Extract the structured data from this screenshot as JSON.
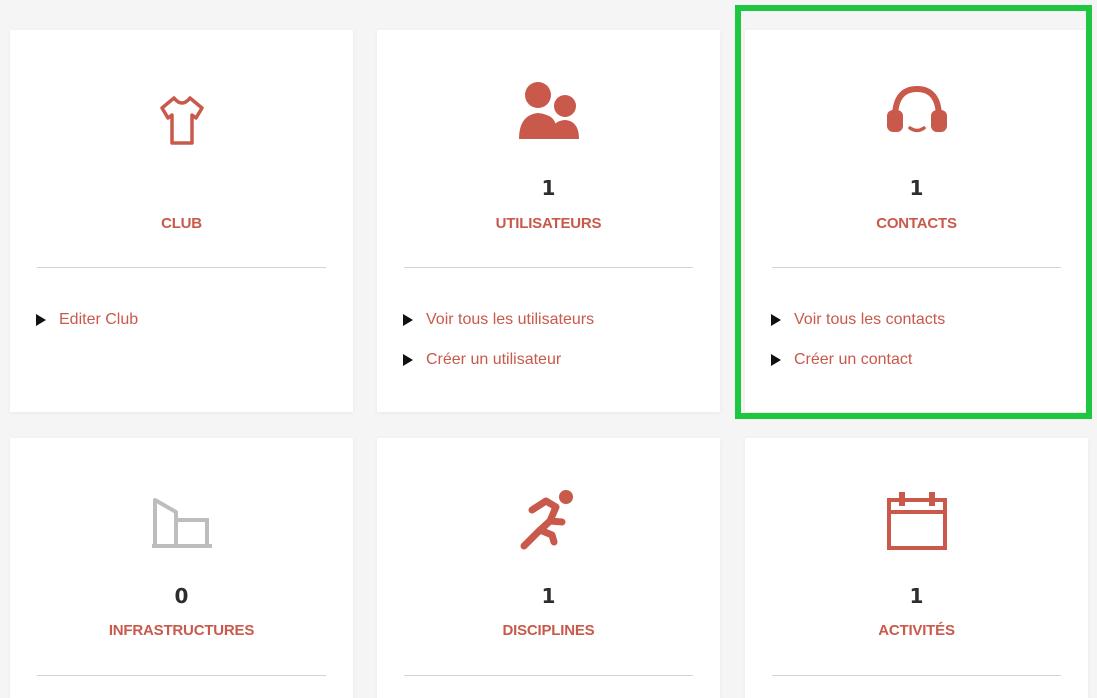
{
  "colors": {
    "accent": "#c8594b",
    "muted": "#bdbdbd",
    "highlight": "#1fc63f",
    "text": "#2d2d2d"
  },
  "cards": [
    {
      "icon": "tshirt-icon",
      "title": "CLUB",
      "count": "",
      "links": [
        {
          "label": "Editer Club"
        }
      ]
    },
    {
      "icon": "users-icon",
      "title": "UTILISATEURS",
      "count": "1",
      "links": [
        {
          "label": "Voir tous les utilisateurs"
        },
        {
          "label": "Créer un utilisateur"
        }
      ]
    },
    {
      "icon": "headset-icon",
      "title": "CONTACTS",
      "count": "1",
      "links": [
        {
          "label": "Voir tous les contacts"
        },
        {
          "label": "Créer un contact"
        }
      ]
    },
    {
      "icon": "building-icon",
      "title": "INFRASTRUCTURES",
      "count": "0",
      "links": []
    },
    {
      "icon": "runner-icon",
      "title": "DISCIPLINES",
      "count": "1",
      "links": []
    },
    {
      "icon": "calendar-icon",
      "title": "ACTIVITÉS",
      "count": "1",
      "links": []
    }
  ]
}
